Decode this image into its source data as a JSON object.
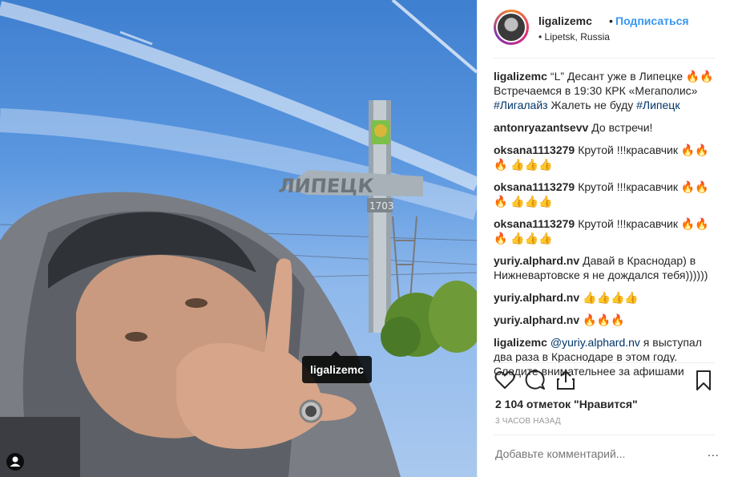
{
  "post": {
    "tag_label": "ligalizemc"
  },
  "header": {
    "username": "ligalizemc",
    "separator": "•",
    "follow_label": "Подписаться",
    "location": "• Lipetsk, Russia"
  },
  "comments": [
    {
      "user": "ligalizemc",
      "parts": [
        {
          "text": "“L” Десант уже в Липецке 🔥🔥 Встречаемся в 19:30 КРК «Мегаполис» ",
          "link": false
        },
        {
          "text": "#Лигалайз",
          "link": true
        },
        {
          "text": " Жалеть не буду ",
          "link": false
        },
        {
          "text": "#Липецк",
          "link": true
        }
      ]
    },
    {
      "user": "antonryazantsevv",
      "parts": [
        {
          "text": "До встречи!",
          "link": false
        }
      ]
    },
    {
      "user": "oksana1113279",
      "parts": [
        {
          "text": "Крутой !!!красавчик 🔥🔥🔥 👍👍👍",
          "link": false
        }
      ]
    },
    {
      "user": "oksana1113279",
      "parts": [
        {
          "text": "Крутой !!!красавчик 🔥🔥🔥 👍👍👍",
          "link": false
        }
      ]
    },
    {
      "user": "oksana1113279",
      "parts": [
        {
          "text": "Крутой !!!красавчик 🔥🔥🔥 👍👍👍",
          "link": false
        }
      ]
    },
    {
      "user": "yuriy.alphard.nv",
      "parts": [
        {
          "text": "Давай в Краснодар) в Нижневартовске я не дождался тебя))))))",
          "link": false
        }
      ]
    },
    {
      "user": "yuriy.alphard.nv",
      "parts": [
        {
          "text": "👍👍👍👍",
          "link": false
        }
      ]
    },
    {
      "user": "yuriy.alphard.nv",
      "parts": [
        {
          "text": "🔥🔥🔥",
          "link": false
        }
      ]
    },
    {
      "user": "ligalizemc",
      "parts": [
        {
          "text": "@yuriy.alphard.nv",
          "link": true
        },
        {
          "text": " я выступал два раза в Краснодаре в этом году. Следите внимательнее за афишами",
          "link": false
        }
      ]
    }
  ],
  "actions": {
    "like_icon": "heart-icon",
    "comment_icon": "comment-icon",
    "share_icon": "share-icon",
    "save_icon": "bookmark-icon"
  },
  "likes": "2 104 отметок \"Нравится\"",
  "time": "3 ЧАСОВ НАЗАД",
  "add_comment": {
    "placeholder": "Добавьте комментарий...",
    "more_label": "..."
  }
}
